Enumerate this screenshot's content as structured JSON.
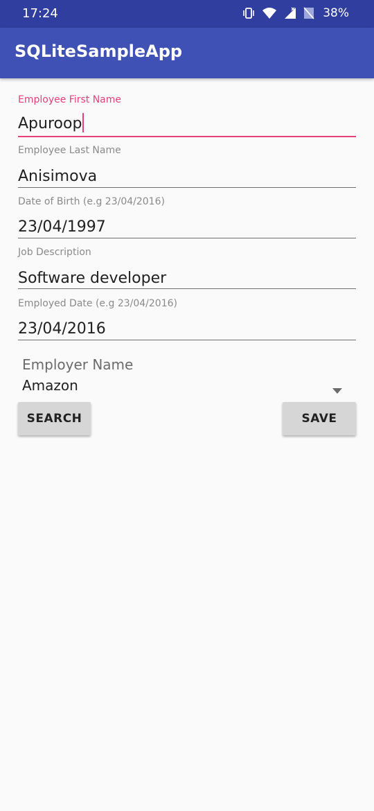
{
  "status_bar": {
    "time": "17:24",
    "battery_percent": "38%",
    "icons": [
      "vibrate-icon",
      "wifi-icon",
      "cellular-signal-icon",
      "no-sim-signal-icon",
      "battery-icon"
    ]
  },
  "app_bar": {
    "title": "SQLiteSampleApp"
  },
  "form": {
    "first_name": {
      "label": "Employee First Name",
      "value": "Apuroop"
    },
    "last_name": {
      "label": "Employee Last Name",
      "value": "Anisimova"
    },
    "dob": {
      "label": "Date of Birth (e.g 23/04/2016)",
      "value": "23/04/1997"
    },
    "job": {
      "label": "Job Description",
      "value": "Software developer"
    },
    "employed_date": {
      "label": "Employed Date (e.g 23/04/2016)",
      "value": "23/04/2016"
    },
    "employer": {
      "label": "Employer Name",
      "value": "Amazon"
    }
  },
  "buttons": {
    "search": "SEARCH",
    "save": "SAVE"
  },
  "colors": {
    "status_bar": "#303f9f",
    "app_bar": "#3f51b5",
    "accent": "#e6407a",
    "button": "#d6d6d6"
  }
}
